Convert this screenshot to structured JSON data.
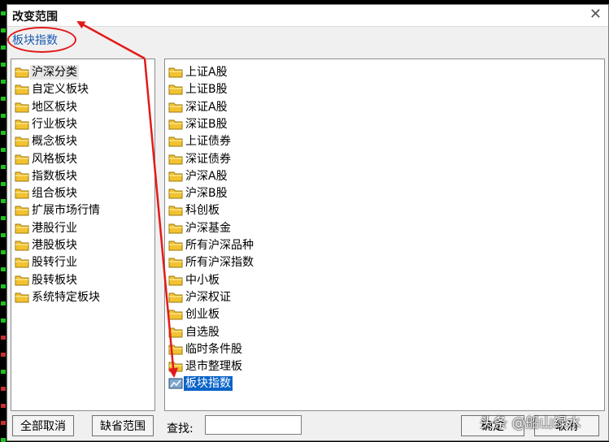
{
  "window": {
    "title": "改变范围",
    "close_glyph": "✕"
  },
  "breadcrumb": "板块指数",
  "left_tree": {
    "items": [
      {
        "label": "沪深分类",
        "icon": "folder-icon",
        "selected": true
      },
      {
        "label": "自定义板块",
        "icon": "folder-icon"
      },
      {
        "label": "地区板块",
        "icon": "folder-icon"
      },
      {
        "label": "行业板块",
        "icon": "folder-icon"
      },
      {
        "label": "概念板块",
        "icon": "folder-icon"
      },
      {
        "label": "风格板块",
        "icon": "folder-icon"
      },
      {
        "label": "指数板块",
        "icon": "folder-icon"
      },
      {
        "label": "组合板块",
        "icon": "folder-icon"
      },
      {
        "label": "扩展市场行情",
        "icon": "folder-icon"
      },
      {
        "label": "港股行业",
        "icon": "folder-icon"
      },
      {
        "label": "港股板块",
        "icon": "folder-icon"
      },
      {
        "label": "股转行业",
        "icon": "folder-icon"
      },
      {
        "label": "股转板块",
        "icon": "folder-icon"
      },
      {
        "label": "系统特定板块",
        "icon": "folder-icon"
      }
    ]
  },
  "right_list": {
    "items": [
      {
        "label": "上证A股",
        "icon": "folder-icon"
      },
      {
        "label": "上证B股",
        "icon": "folder-icon"
      },
      {
        "label": "深证A股",
        "icon": "folder-icon"
      },
      {
        "label": "深证B股",
        "icon": "folder-icon"
      },
      {
        "label": "上证债券",
        "icon": "folder-icon"
      },
      {
        "label": "深证债券",
        "icon": "folder-icon"
      },
      {
        "label": "沪深A股",
        "icon": "folder-icon"
      },
      {
        "label": "沪深B股",
        "icon": "folder-icon"
      },
      {
        "label": "科创板",
        "icon": "folder-icon"
      },
      {
        "label": "沪深基金",
        "icon": "folder-icon"
      },
      {
        "label": "所有沪深品种",
        "icon": "folder-icon"
      },
      {
        "label": "所有沪深指数",
        "icon": "folder-icon"
      },
      {
        "label": "中小板",
        "icon": "folder-icon"
      },
      {
        "label": "沪深权证",
        "icon": "folder-icon"
      },
      {
        "label": "创业板",
        "icon": "folder-icon"
      },
      {
        "label": "自选股",
        "icon": "folder-icon"
      },
      {
        "label": "临时条件股",
        "icon": "folder-icon"
      },
      {
        "label": "退市整理板",
        "icon": "folder-icon"
      },
      {
        "label": "板块指数",
        "icon": "index-icon",
        "selected": true
      }
    ]
  },
  "bottom": {
    "cancel_all_label": "全部取消",
    "default_range_label": "缺省范围",
    "search_label": "查找:",
    "search_value": "",
    "ok_label": "确定",
    "cancel_label": "取消"
  },
  "watermark": "头条 @船山绿水",
  "colors": {
    "annotation_red": "#e31a1a",
    "selection_blue": "#0a64c8",
    "breadcrumb_blue": "#1b5bb0",
    "folder_yellow": "#f2c230"
  }
}
